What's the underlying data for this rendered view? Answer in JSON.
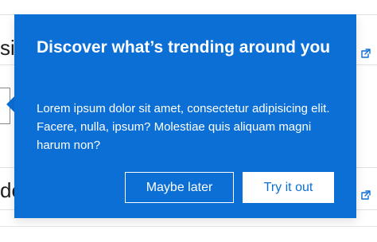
{
  "background": {
    "top_fragment_text": "si",
    "bottom_fragment_text": "de",
    "external_link_icons": [
      "external-link-icon",
      "external-link-icon"
    ]
  },
  "popup": {
    "title": "Discover what’s trending around you",
    "body": "Lorem ipsum dolor sit amet, consectetur adipisicing elit. Facere, nulla, ipsum? Molestiae quis aliquam magni harum non?",
    "secondary_button_label": "Maybe later",
    "primary_button_label": "Try it out",
    "colors": {
      "popup_background": "#0b6fd6",
      "text": "#ffffff",
      "primary_button_background": "#ffffff",
      "primary_button_text": "#0b6fd6"
    }
  }
}
